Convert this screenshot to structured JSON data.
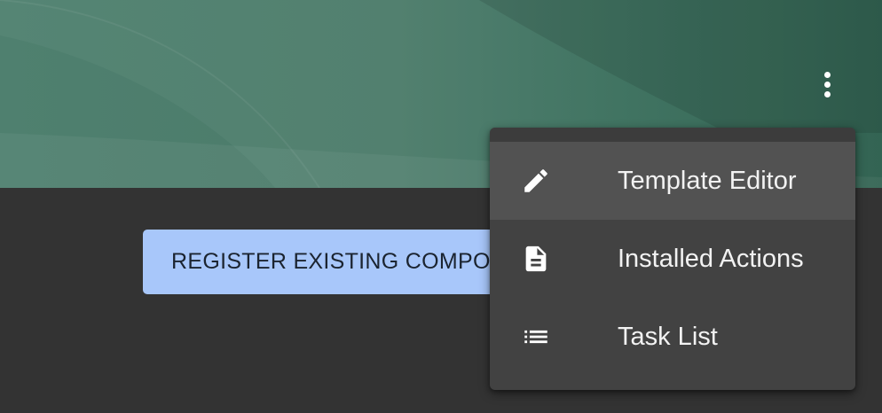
{
  "header": {
    "more_icon": "more-vert-icon"
  },
  "main": {
    "register_button_label": "REGISTER EXISTING COMPONENT"
  },
  "menu": {
    "items": [
      {
        "label": "Template Editor",
        "icon": "pencil-icon",
        "highlighted": true
      },
      {
        "label": "Installed Actions",
        "icon": "document-icon",
        "highlighted": false
      },
      {
        "label": "Task List",
        "icon": "list-icon",
        "highlighted": false
      }
    ]
  },
  "colors": {
    "header_green": "#4b7b6a",
    "page_background": "#333333",
    "button_blue": "#a8c7fa",
    "menu_background": "#424242",
    "menu_highlight": "#525252"
  }
}
